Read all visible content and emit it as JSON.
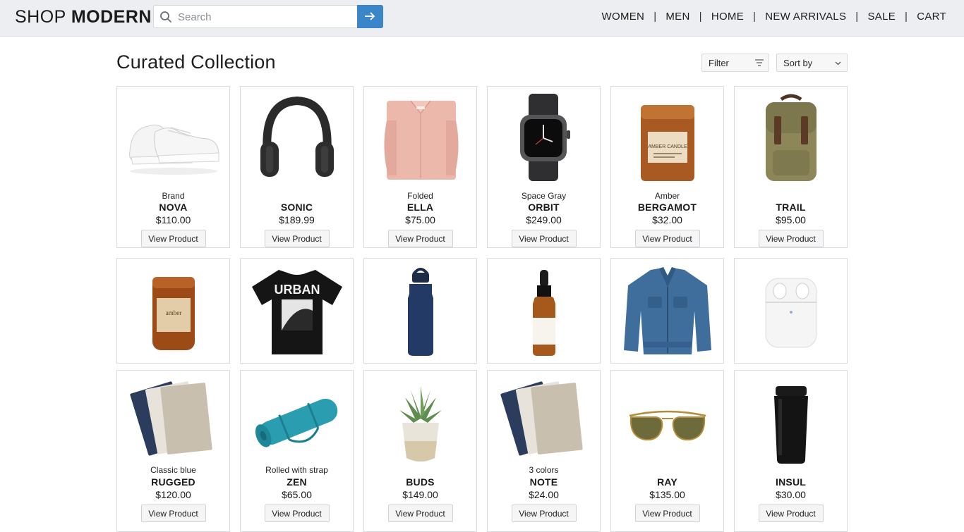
{
  "logo": {
    "part1": "SHOP",
    "part2": "MODERN"
  },
  "search": {
    "placeholder": "Search"
  },
  "nav": [
    "WOMEN",
    "MEN",
    "HOME",
    "NEW ARRIVALS",
    "SALE",
    "CART"
  ],
  "page": {
    "title": "Curated Collection",
    "filter_label": "Filter",
    "sort_label": "Sort by"
  },
  "button_label": "View Product",
  "colors": {
    "accent": "#3b86c8",
    "topbar": "#eceef1"
  },
  "products_row1": [
    {
      "sub": "Brand",
      "name": "NOVA",
      "price": "$110.00",
      "icon": "white-sneakers"
    },
    {
      "sub": "",
      "name": "SONIC",
      "price": "$189.99",
      "icon": "black-headphones"
    },
    {
      "sub": "Folded",
      "name": "ELLA",
      "price": "$75.00",
      "icon": "pink-shirt"
    },
    {
      "sub": "Space Gray",
      "name": "ORBIT",
      "price": "$249.00",
      "icon": "smartwatch"
    },
    {
      "sub": "Amber",
      "name": "BERGAMOT",
      "price": "$32.00",
      "icon": "amber-candle-tall",
      "jar_label": "AMBER CANDLE"
    },
    {
      "sub": "",
      "name": "TRAIL",
      "price": "$95.00",
      "icon": "canvas-backpack"
    }
  ],
  "products_row2": [
    {
      "icon": "amber-candle-jar",
      "jar_label": "amber"
    },
    {
      "icon": "urban-tshirt",
      "shirt_text": "URBAN"
    },
    {
      "icon": "navy-water-bottle"
    },
    {
      "icon": "dropper-bottle"
    },
    {
      "icon": "denim-jacket"
    },
    {
      "icon": "earbuds-case"
    }
  ],
  "products_row3": [
    {
      "sub": "Classic blue",
      "name": "RUGGED",
      "price": "$120.00",
      "icon": "notebooks"
    },
    {
      "sub": "Rolled with strap",
      "name": "ZEN",
      "price": "$65.00",
      "icon": "yoga-mat"
    },
    {
      "sub": "",
      "name": "BUDS",
      "price": "$149.00",
      "icon": "succulent-pot"
    },
    {
      "sub": "3 colors",
      "name": "NOTE",
      "price": "$24.00",
      "icon": "notebooks"
    },
    {
      "sub": "",
      "name": "RAY",
      "price": "$135.00",
      "icon": "aviator-sunglasses"
    },
    {
      "sub": "",
      "name": "INSUL",
      "price": "$30.00",
      "icon": "black-tumbler"
    }
  ]
}
